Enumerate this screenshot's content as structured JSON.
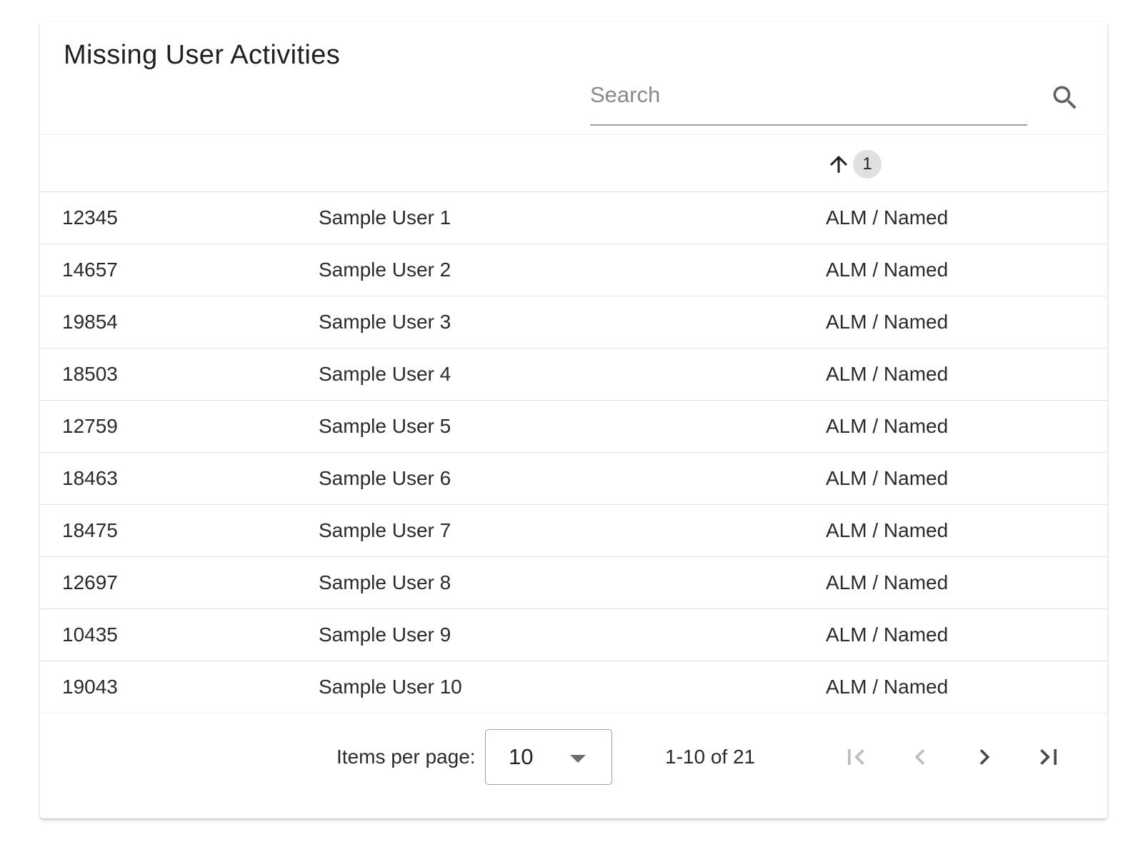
{
  "card": {
    "title": "Missing User Activities"
  },
  "search": {
    "placeholder": "Search",
    "value": "",
    "icon": "search-icon"
  },
  "table": {
    "sort": {
      "direction": "ascending",
      "icon": "arrow-up-icon",
      "order": "1"
    },
    "rows": [
      {
        "id": "12345",
        "name": "Sample User 1",
        "type": "ALM / Named"
      },
      {
        "id": "14657",
        "name": "Sample User 2",
        "type": "ALM / Named"
      },
      {
        "id": "19854",
        "name": "Sample User 3",
        "type": "ALM / Named"
      },
      {
        "id": "18503",
        "name": "Sample User 4",
        "type": "ALM / Named"
      },
      {
        "id": "12759",
        "name": "Sample User 5",
        "type": "ALM / Named"
      },
      {
        "id": "18463",
        "name": "Sample User 6",
        "type": "ALM / Named"
      },
      {
        "id": "18475",
        "name": "Sample User 7",
        "type": "ALM / Named"
      },
      {
        "id": "12697",
        "name": "Sample User 8",
        "type": "ALM / Named"
      },
      {
        "id": "10435",
        "name": "Sample User 9",
        "type": "ALM / Named"
      },
      {
        "id": "19043",
        "name": "Sample User 10",
        "type": "ALM / Named"
      }
    ]
  },
  "paginator": {
    "items_per_page_label": "Items per page:",
    "items_per_page_value": "10",
    "range_label": "1-10 of 21",
    "buttons": {
      "first": {
        "icon": "first-page-icon",
        "enabled": false
      },
      "previous": {
        "icon": "chevron-left-icon",
        "enabled": false
      },
      "next": {
        "icon": "chevron-right-icon",
        "enabled": true
      },
      "last": {
        "icon": "last-page-icon",
        "enabled": true
      }
    }
  },
  "colors": {
    "text": "#212121",
    "divider": "#e0e0e0",
    "disabled_icon": "#bdbdbd",
    "enabled_icon": "#4a4a4a",
    "sort_badge": "#e0e0e0"
  }
}
